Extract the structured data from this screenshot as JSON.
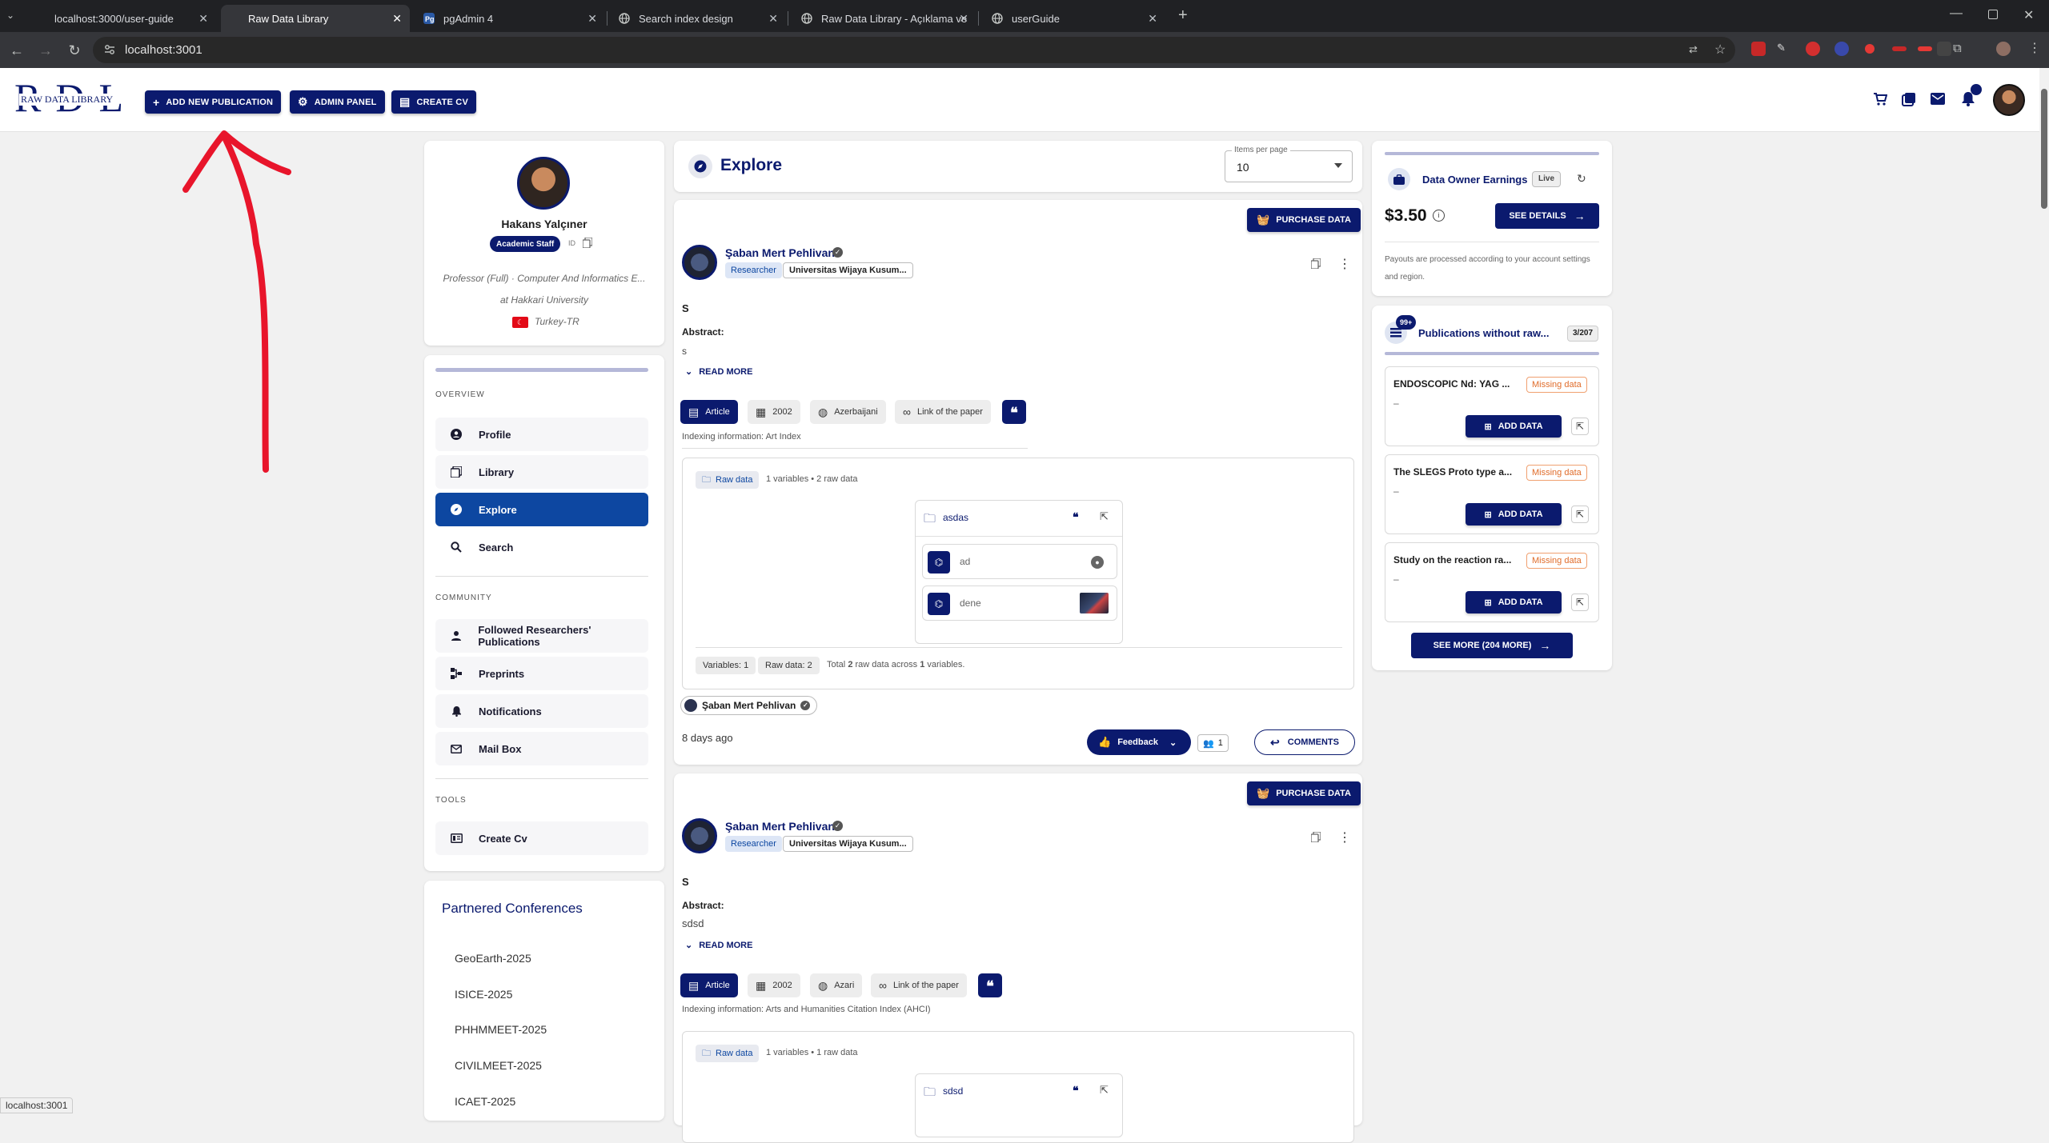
{
  "browser": {
    "tabs": [
      {
        "title": "localhost:3000/user-guide"
      },
      {
        "title": "Raw Data Library"
      },
      {
        "title": "pgAdmin 4"
      },
      {
        "title": "Search index design"
      },
      {
        "title": "Raw Data Library - Açıklama ve"
      },
      {
        "title": "userGuide"
      }
    ],
    "url": "localhost:3001",
    "status_url": "localhost:3001"
  },
  "header": {
    "logo_text": "RDL",
    "logo_sub": "RAW DATA LIBRARY",
    "buttons": {
      "add_publication": "ADD NEW PUBLICATION",
      "admin_panel": "ADMIN PANEL",
      "create_cv": "CREATE CV"
    }
  },
  "profile": {
    "name": "Hakans Yalçıner",
    "badge": "Academic Staff",
    "id_label": "ID",
    "title": "Professor (Full) · Computer And Informatics E...",
    "university": "at Hakkari University",
    "locale": "Turkey-TR"
  },
  "nav": {
    "overview_label": "OVERVIEW",
    "overview": [
      "Profile",
      "Library",
      "Explore",
      "Search"
    ],
    "community_label": "COMMUNITY",
    "community": [
      "Followed Researchers' Publications",
      "Preprints",
      "Notifications",
      "Mail Box"
    ],
    "tools_label": "TOOLS",
    "tools": [
      "Create Cv"
    ]
  },
  "conferences": {
    "title": "Partnered Conferences",
    "items": [
      "GeoEarth-2025",
      "ISICE-2025",
      "PHHMMEET-2025",
      "CIVILMEET-2025",
      "ICAET-2025"
    ]
  },
  "explore": {
    "title": "Explore",
    "items_per_page_label": "Items per page",
    "items_per_page": "10"
  },
  "posts": [
    {
      "purchase": "PURCHASE DATA",
      "author": "Şaban Mert Pehlivan",
      "role": "Researcher",
      "affiliation": "Universitas Wijaya Kusum...",
      "title": "S",
      "abstract_label": "Abstract:",
      "abstract": "s",
      "read_more": "READ MORE",
      "type": "Article",
      "year": "2002",
      "language": "Azerbaijani",
      "link": "Link of the paper",
      "indexing": "Indexing information: Art Index",
      "raw_label": "Raw data",
      "raw_summary": "1 variables • 2 raw data",
      "folder": "asdas",
      "files": [
        "ad",
        "dene"
      ],
      "vars_chip": "Variables: 1",
      "raw_chip": "Raw data: 2",
      "total_prefix": "Total",
      "total_raw": "2",
      "total_mid": "raw data across",
      "total_vars": "1",
      "total_suffix": "variables.",
      "contributor": "Şaban Mert Pehlivan",
      "time": "8 days ago",
      "feedback": "Feedback",
      "followers": "1",
      "comments": "COMMENTS"
    },
    {
      "purchase": "PURCHASE DATA",
      "author": "Şaban Mert Pehlivan",
      "role": "Researcher",
      "affiliation": "Universitas Wijaya Kusum...",
      "title": "S",
      "abstract_label": "Abstract:",
      "abstract": "sdsd",
      "read_more": "READ MORE",
      "type": "Article",
      "year": "2002",
      "language": "Azari",
      "link": "Link of the paper",
      "indexing": "Indexing information: Arts and Humanities Citation Index (AHCI)",
      "raw_label": "Raw data",
      "raw_summary": "1 variables • 1 raw data",
      "folder": "sdsd"
    }
  ],
  "earnings": {
    "title": "Data Owner Earnings",
    "live": "Live",
    "amount": "$3.50",
    "details": "SEE DETAILS",
    "note": "Payouts are processed according to your account settings and region."
  },
  "missing": {
    "badge": "99+",
    "title": "Publications without raw...",
    "count": "3/207",
    "items": [
      {
        "title": "ENDOSCOPIC Nd: YAG ...",
        "tag": "Missing data",
        "dash": "–",
        "btn": "ADD DATA"
      },
      {
        "title": "The SLEGS Proto type a...",
        "tag": "Missing data",
        "dash": "–",
        "btn": "ADD DATA"
      },
      {
        "title": "Study on the reaction ra...",
        "tag": "Missing data",
        "dash": "–",
        "btn": "ADD DATA"
      }
    ],
    "see_more": "SEE MORE (204 MORE)"
  },
  "colors": {
    "primary": "#0b1a6e",
    "active_nav": "#0d47a1",
    "annotation": "#e8152b",
    "missing": "#e06c2a"
  }
}
